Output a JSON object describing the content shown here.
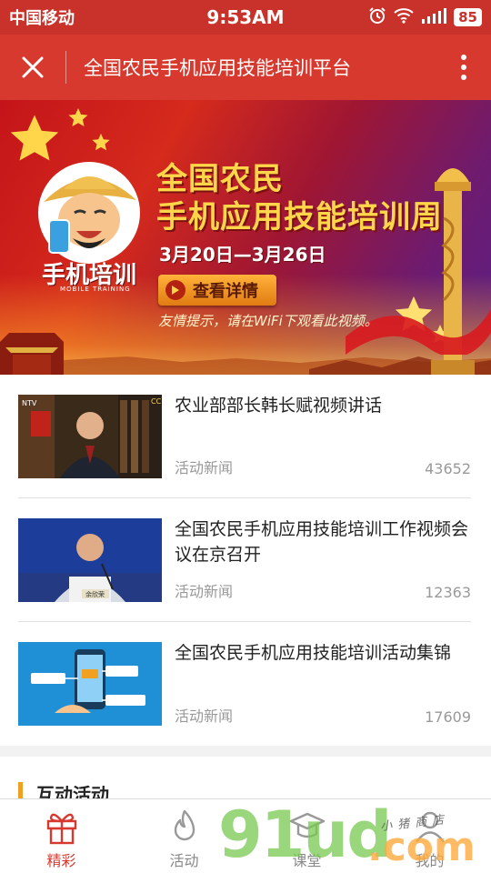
{
  "status_bar": {
    "carrier": "中国移动",
    "time": "9:53AM",
    "battery": "85"
  },
  "title_bar": {
    "title": "全国农民手机应用技能培训平台"
  },
  "banner": {
    "title_line1": "全国农民",
    "title_line2": "手机应用技能培训周",
    "date_range": "3月20日—3月26日",
    "cta_label": "查看详情",
    "tip": "友情提示，请在WiFi下观看此视频。",
    "logo_text": "手机培训",
    "logo_sub": "MOBILE TRAINING"
  },
  "news": [
    {
      "title": "农业部部长韩长赋视频讲话",
      "category": "活动新闻",
      "views": "43652",
      "thumb_icon": "video-thumbnail-icon"
    },
    {
      "title": "全国农民手机应用技能培训工作视频会议在京召开",
      "category": "活动新闻",
      "views": "12363",
      "thumb_icon": "video-thumbnail-icon"
    },
    {
      "title": "全国农民手机应用技能培训活动集锦",
      "category": "活动新闻",
      "views": "17609",
      "thumb_icon": "infographic-thumbnail-icon"
    }
  ],
  "section": {
    "title": "互动活动"
  },
  "tabs": [
    {
      "label": "精彩",
      "icon": "gift-icon",
      "active": true
    },
    {
      "label": "活动",
      "icon": "flame-icon",
      "active": false
    },
    {
      "label": "课堂",
      "icon": "graduation-cap-icon",
      "active": false
    },
    {
      "label": "我的",
      "icon": "user-icon",
      "active": false
    }
  ],
  "watermark": {
    "brand": "91ud",
    "tld": ".com",
    "tagline": "小猪商店"
  },
  "colors": {
    "primary": "#d8392f",
    "status_bar": "#c9322b",
    "accent_gold": "#ffd54a",
    "section_bar": "#f0a020",
    "muted_text": "#999999"
  }
}
